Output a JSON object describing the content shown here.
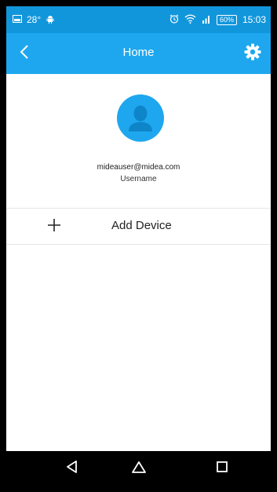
{
  "status_bar": {
    "temperature": "28°",
    "battery": "60%",
    "time": "15:03",
    "icons": [
      "screenshot-icon",
      "android-icon",
      "alarm-icon",
      "wifi-icon",
      "signal-icon"
    ]
  },
  "header": {
    "title": "Home",
    "back_icon": "chevron-left-icon",
    "settings_icon": "gear-icon"
  },
  "profile": {
    "avatar_icon": "user-silhouette-icon",
    "email": "mideauser@midea.com",
    "username": "Username"
  },
  "add_device": {
    "icon": "plus-icon",
    "label": "Add Device"
  },
  "nav_bar": {
    "icons": [
      "back-triangle-icon",
      "home-icon",
      "recents-icon"
    ]
  },
  "colors": {
    "status_bar": "#1296db",
    "app_bar": "#1ea7ee",
    "avatar": "#1ea7ee",
    "avatar_figure": "#0f85c9",
    "nav_bar": "#000000"
  }
}
